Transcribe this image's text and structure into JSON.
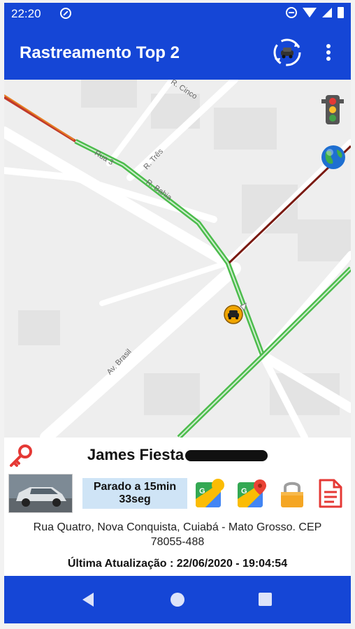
{
  "status_bar": {
    "time": "22:20",
    "icons": [
      "do-not-disturb-icon",
      "mute-icon",
      "wifi-icon",
      "signal-icon",
      "battery-icon"
    ]
  },
  "app_bar": {
    "title": "Rastreamento Top 2",
    "actions": [
      "sync-vehicle-icon",
      "more-vert-icon"
    ]
  },
  "map": {
    "street_labels": {
      "r_cinco": "R. Cinco",
      "r_tres": "R. Três",
      "rua_a": "Rua 3",
      "r_bahia": "R. Bahia",
      "av_brasil": "Av. Brasil"
    },
    "controls": [
      "traffic-light-icon",
      "globe-icon"
    ]
  },
  "info": {
    "vehicle_name": "James Fiesta",
    "stopped_line1": "Parado a 15min",
    "stopped_line2": "33seg",
    "address_line1": "Rua Quatro, Nova Conquista, Cuiabá - Mato Grosso. CEP",
    "address_line2": "78055-488",
    "last_update": "Última Atualização : 22/06/2020 - 19:04:54"
  },
  "colors": {
    "primary": "#1546d6",
    "route_green": "#4cbc4c",
    "route_red": "#7a1a12",
    "badge_bg": "#cfe4f6"
  }
}
